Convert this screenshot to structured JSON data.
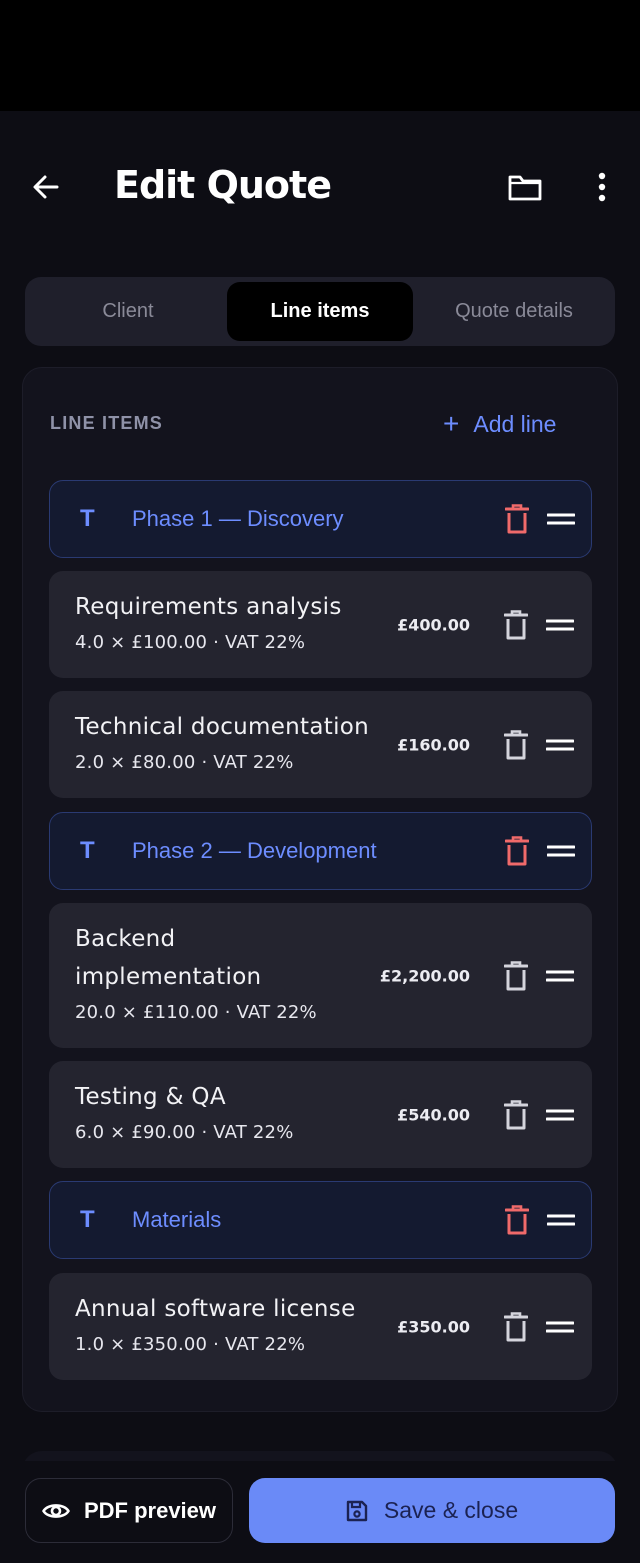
{
  "header": {
    "title": "Edit Quote",
    "back_icon": "arrow-left-icon",
    "folder_icon": "folder-icon",
    "more_icon": "more-vertical-icon"
  },
  "tabs": [
    {
      "label": "Client",
      "active": false
    },
    {
      "label": "Line items",
      "active": true
    },
    {
      "label": "Quote details",
      "active": false
    }
  ],
  "line_items": {
    "section_label": "LINE ITEMS",
    "add_line_label": "Add line",
    "sections": [
      {
        "title": "Phase 1 — Discovery"
      },
      {
        "title": "Phase 2 — Development"
      },
      {
        "title": "Materials"
      }
    ],
    "items": [
      {
        "name": "Requirements analysis",
        "detail": "4.0 × £100.00  · VAT 22%",
        "price": "£400.00"
      },
      {
        "name": "Technical documentation",
        "detail": "2.0 × £80.00  · VAT 22%",
        "price": "£160.00"
      },
      {
        "name_line1": "Backend",
        "name_line2": "implementation",
        "detail": "20.0 × £110.00  · VAT 22%",
        "price": "£2,200.00"
      },
      {
        "name": "Testing & QA",
        "detail": "6.0 × £90.00  · VAT 22%",
        "price": "£540.00"
      },
      {
        "name": "Annual software license",
        "detail": "1.0 × £350.00  · VAT 22%",
        "price": "£350.00"
      }
    ]
  },
  "footer": {
    "pdf_label": "PDF preview",
    "save_label": "Save & close"
  },
  "colors": {
    "accent": "#6d8dff",
    "danger": "#f06a6a",
    "save_button": "#6a8af7"
  }
}
